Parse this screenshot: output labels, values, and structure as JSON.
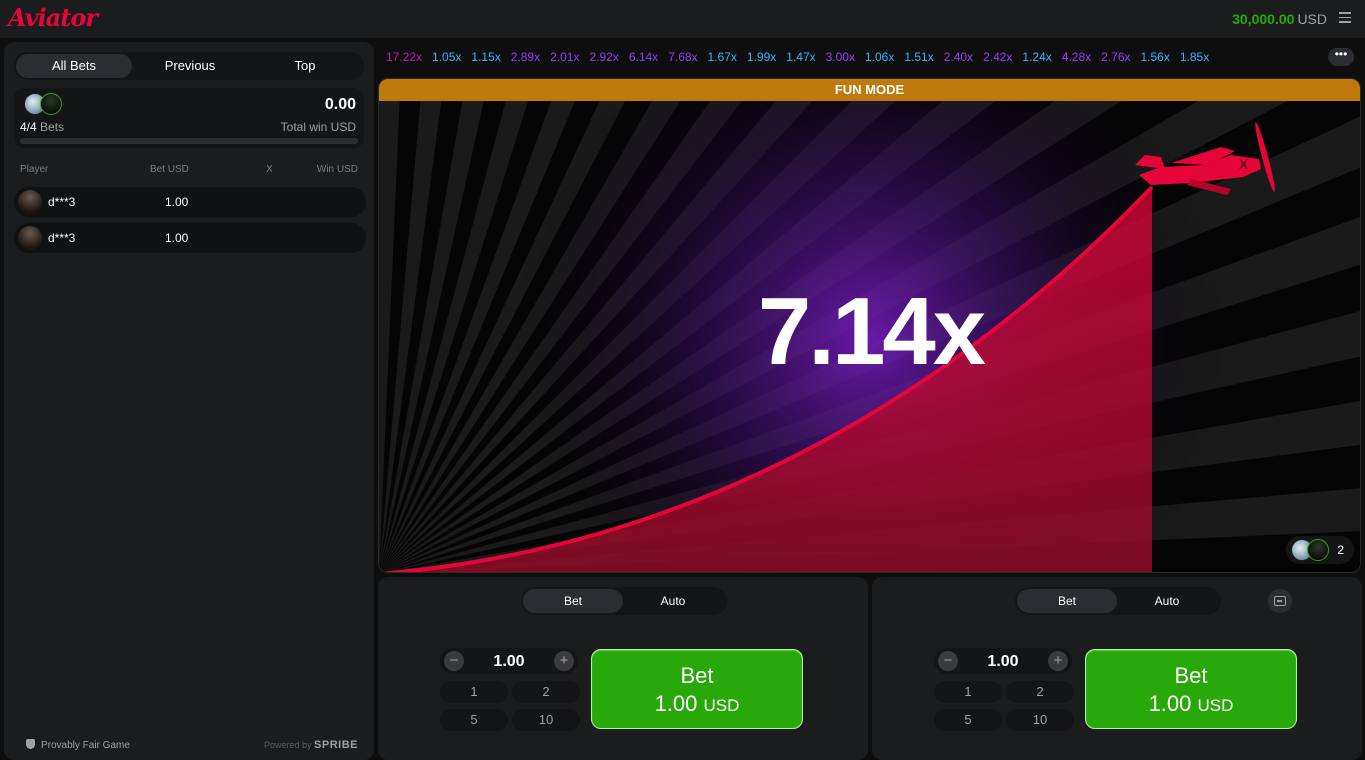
{
  "header": {
    "logo": "Aviator",
    "balance_amount": "30,000.00",
    "balance_currency": "USD"
  },
  "left_panel": {
    "tabs": [
      "All Bets",
      "Previous",
      "Top"
    ],
    "active_tab": "All Bets",
    "summary": {
      "bet_count": "4/4",
      "bets_label": "Bets",
      "total_win": "0.00",
      "total_win_label": "Total win USD"
    },
    "columns": [
      "Player",
      "Bet USD",
      "X",
      "Win USD"
    ],
    "rows": [
      {
        "player": "d***3",
        "bet": "1.00"
      },
      {
        "player": "d***3",
        "bet": "1.00"
      }
    ],
    "footer": {
      "provably_fair": "Provably Fair Game",
      "powered_by": "Powered by",
      "brand": "SPRIBE"
    }
  },
  "multipliers": [
    {
      "value": "17.22x",
      "color": "#c017b4"
    },
    {
      "value": "1.05x",
      "color": "#34b4ff"
    },
    {
      "value": "1.15x",
      "color": "#34b4ff"
    },
    {
      "value": "2.89x",
      "color": "#913ef8"
    },
    {
      "value": "2.01x",
      "color": "#913ef8"
    },
    {
      "value": "2.92x",
      "color": "#913ef8"
    },
    {
      "value": "6.14x",
      "color": "#913ef8"
    },
    {
      "value": "7.68x",
      "color": "#913ef8"
    },
    {
      "value": "1.67x",
      "color": "#34b4ff"
    },
    {
      "value": "1.99x",
      "color": "#34b4ff"
    },
    {
      "value": "1.47x",
      "color": "#34b4ff"
    },
    {
      "value": "3.00x",
      "color": "#913ef8"
    },
    {
      "value": "1.06x",
      "color": "#34b4ff"
    },
    {
      "value": "1.51x",
      "color": "#34b4ff"
    },
    {
      "value": "2.40x",
      "color": "#913ef8"
    },
    {
      "value": "2.42x",
      "color": "#913ef8"
    },
    {
      "value": "1.24x",
      "color": "#34b4ff"
    },
    {
      "value": "4.28x",
      "color": "#913ef8"
    },
    {
      "value": "2.76x",
      "color": "#913ef8"
    },
    {
      "value": "1.56x",
      "color": "#34b4ff"
    },
    {
      "value": "1.85x",
      "color": "#34b4ff"
    }
  ],
  "game": {
    "mode_banner": "FUN MODE",
    "current_multiplier": "7.14x",
    "players_count": "2"
  },
  "bet_panels": [
    {
      "tabs": [
        "Bet",
        "Auto"
      ],
      "active_tab": "Bet",
      "amount": "1.00",
      "quick_amounts": [
        "1",
        "2",
        "5",
        "10"
      ],
      "button_label": "Bet",
      "button_amount": "1.00",
      "button_currency": "USD"
    },
    {
      "tabs": [
        "Bet",
        "Auto"
      ],
      "active_tab": "Bet",
      "amount": "1.00",
      "quick_amounts": [
        "1",
        "2",
        "5",
        "10"
      ],
      "button_label": "Bet",
      "button_amount": "1.00",
      "button_currency": "USD"
    }
  ],
  "colors": {
    "accent_red": "#e50539",
    "bet_green": "#28a909",
    "fun_mode_orange": "#bf7a0d"
  }
}
